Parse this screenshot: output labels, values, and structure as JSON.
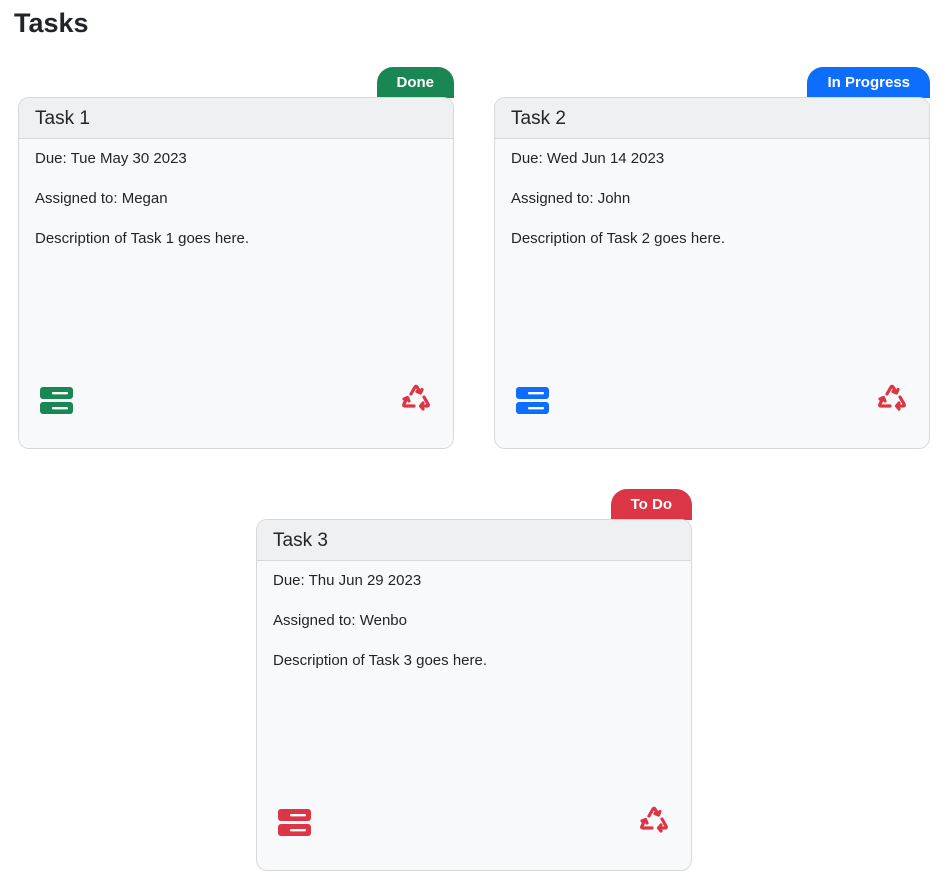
{
  "page": {
    "title": "Tasks"
  },
  "colors": {
    "done": "#198754",
    "in_progress": "#0d6efd",
    "todo": "#dc3545",
    "delete": "#dc3545"
  },
  "tasks": [
    {
      "title": "Task 1",
      "status": "Done",
      "due": "Due: Tue May 30 2023",
      "assigned": "Assigned to: Megan",
      "description": "Description of Task 1 goes here.",
      "left_icon": "server-icon",
      "right_icon": "recycle-icon"
    },
    {
      "title": "Task 2",
      "status": "In Progress",
      "due": "Due: Wed Jun 14 2023",
      "assigned": "Assigned to: John",
      "description": "Description of Task 2 goes here.",
      "left_icon": "server-icon",
      "right_icon": "recycle-icon"
    },
    {
      "title": "Task 3",
      "status": "To Do",
      "due": "Due: Thu Jun 29 2023",
      "assigned": "Assigned to: Wenbo",
      "description": "Description of Task 3 goes here.",
      "left_icon": "server-icon",
      "right_icon": "recycle-icon"
    }
  ]
}
